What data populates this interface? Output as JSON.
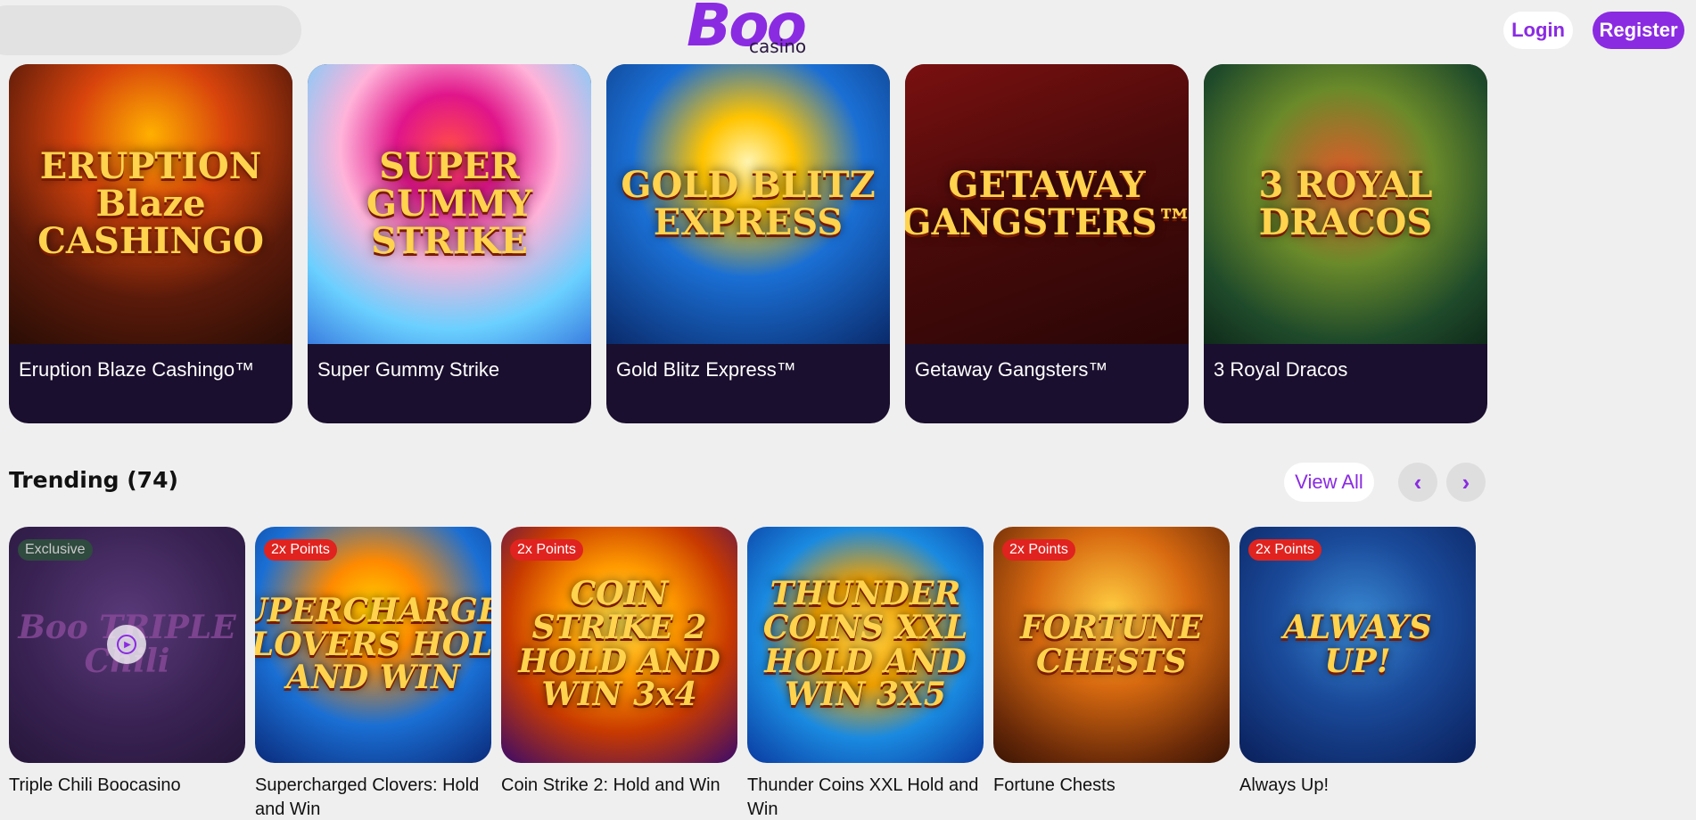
{
  "header": {
    "logo_main": "Boo",
    "logo_sub": "casino",
    "login_label": "Login",
    "register_label": "Register",
    "accent_color": "#8a2be2"
  },
  "featured": [
    {
      "name": "Eruption Blaze Cashingo™",
      "art": "ERUPTION Blaze CASHINGO"
    },
    {
      "name": "Super Gummy Strike",
      "art": "SUPER GUMMY STRIKE"
    },
    {
      "name": "Gold Blitz Express™",
      "art": "GOLD BLITZ EXPRESS"
    },
    {
      "name": "Getaway Gangsters™",
      "art": "GETAWAY GANGSTERS™"
    },
    {
      "name": "3 Royal Dracos",
      "art": "3 ROYAL DRACOS"
    }
  ],
  "trending": {
    "title": "Trending (74)",
    "view_all_label": "View All",
    "prev_icon": "chevron-left-icon",
    "next_icon": "chevron-right-icon",
    "games": [
      {
        "name": "Triple Chili Boocasino",
        "badge": "Exclusive",
        "art": "Boo TRIPLE Chili"
      },
      {
        "name": "Supercharged Clovers: Hold and Win",
        "badge": "2x Points",
        "art": "SUPERCHARGED CLOVERS HOLD AND WIN"
      },
      {
        "name": "Coin Strike 2: Hold and Win",
        "badge": "2x Points",
        "art": "COIN STRIKE 2 HOLD AND WIN 3x4"
      },
      {
        "name": "Thunder Coins XXL Hold and Win",
        "badge": "",
        "art": "THUNDER COINS XXL HOLD AND WIN 3X5"
      },
      {
        "name": "Fortune Chests",
        "badge": "2x Points",
        "art": "FORTUNE CHESTS"
      },
      {
        "name": "Always Up!",
        "badge": "2x Points",
        "art": "ALWAYS UP!"
      }
    ]
  }
}
